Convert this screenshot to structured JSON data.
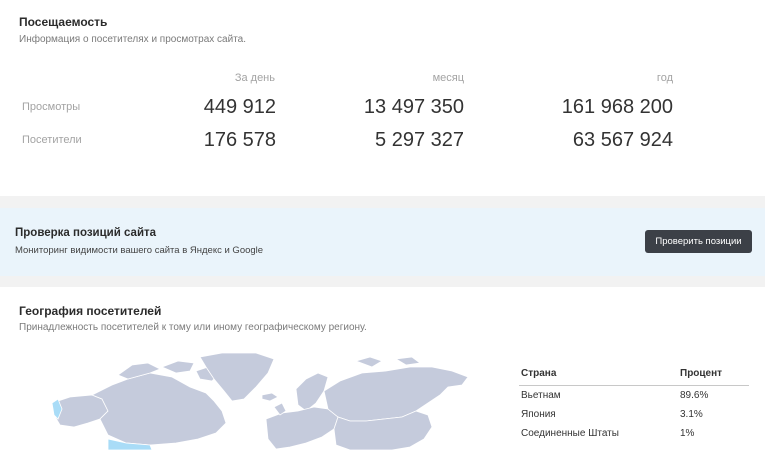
{
  "traffic": {
    "title": "Посещаемость",
    "subtitle": "Информация о посетителях и просмотрах сайта.",
    "columns": [
      "За день",
      "месяц",
      "год"
    ],
    "rows": [
      {
        "label": "Просмотры",
        "values": [
          "449 912",
          "13 497 350",
          "161 968 200"
        ]
      },
      {
        "label": "Посетители",
        "values": [
          "176 578",
          "5 297 327",
          "63 567 924"
        ]
      }
    ]
  },
  "position_check": {
    "title": "Проверка позиций сайта",
    "subtitle": "Мониторинг видимости вашего сайта в Яндекс и Google",
    "button_label": "Проверить позиции"
  },
  "geo": {
    "title": "География посетителей",
    "subtitle": "Принадлежность посетителей к тому или иному географическому региону.",
    "table_headers": {
      "country": "Страна",
      "percent": "Процент"
    },
    "countries": [
      {
        "name": "Вьетнам",
        "percent": "89.6%"
      },
      {
        "name": "Япония",
        "percent": "3.1%"
      },
      {
        "name": "Соединенные Штаты",
        "percent": "1%"
      }
    ],
    "map_colors": {
      "land": "#c5cbdc",
      "highlight": "#a9dcf7",
      "border": "#ffffff"
    }
  }
}
